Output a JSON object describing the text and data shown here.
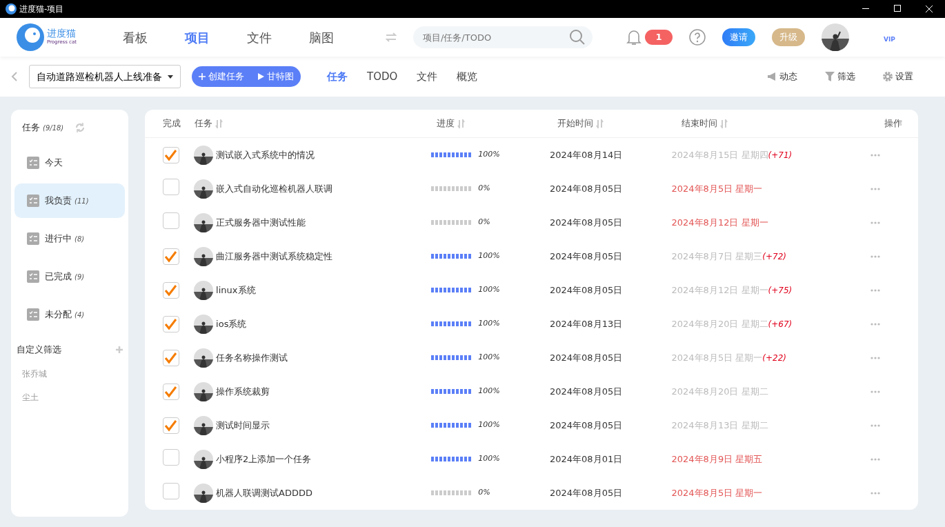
{
  "window": {
    "title": "进度猫-项目"
  },
  "header": {
    "logo_text": "进度猫",
    "logo_sub": "Progress cat",
    "nav": [
      {
        "label": "看板",
        "selected": false
      },
      {
        "label": "项目",
        "selected": true
      },
      {
        "label": "文件",
        "selected": false
      },
      {
        "label": "脑图",
        "selected": false
      }
    ],
    "search": {
      "placeholder": "项目/任务/TODO"
    },
    "notifications": "1",
    "invite": "邀请",
    "upgrade": "升级",
    "vip": "VIP"
  },
  "toolbar": {
    "project": "自动道路巡检机器人上线准备",
    "create": "创建任务",
    "gantt": "甘特图",
    "tabs": [
      {
        "label": "任务",
        "selected": true
      },
      {
        "label": "TODO",
        "selected": false
      },
      {
        "label": "文件",
        "selected": false
      },
      {
        "label": "概览",
        "selected": false
      }
    ],
    "actions": [
      {
        "kind": "activity",
        "label": "动态"
      },
      {
        "kind": "filter",
        "label": "筛选"
      },
      {
        "kind": "settings",
        "label": "设置"
      }
    ]
  },
  "sidebar": {
    "title": "任务",
    "count": "(9/18)",
    "items": [
      {
        "label": "今天",
        "selected": false
      },
      {
        "label": "我负责",
        "count": "(11)",
        "selected": true
      },
      {
        "label": "进行中",
        "count": "(8)",
        "selected": false
      },
      {
        "label": "已完成",
        "count": "(9)",
        "selected": false
      },
      {
        "label": "未分配",
        "count": "(4)",
        "selected": false
      }
    ],
    "custom_title": "自定义筛选",
    "people": [
      "张乔城",
      "尘土"
    ]
  },
  "table": {
    "columns": [
      "完成",
      "任务",
      "进度",
      "开始时间",
      "结束时间",
      "操作"
    ],
    "rows": [
      {
        "checked": true,
        "task": "测试嵌入式系统中的情况",
        "level": 1,
        "progress": "100%",
        "start": "2024年08月14日",
        "end": "2024年8月15日 星期四",
        "overdue": false,
        "delay": "(+71)"
      },
      {
        "checked": false,
        "task": "嵌入式自动化巡检机器人联调",
        "level": 0,
        "progress": "0%",
        "start": "2024年08月05日",
        "end": "2024年8月5日 星期一",
        "overdue": true
      },
      {
        "checked": false,
        "task": "正式服务器中测试性能",
        "level": 0,
        "progress": "0%",
        "start": "2024年08月05日",
        "end": "2024年8月12日 星期一",
        "overdue": true
      },
      {
        "checked": true,
        "task": "曲江服务器中测试系统稳定性",
        "level": 1,
        "progress": "100%",
        "start": "2024年08月05日",
        "end": "2024年8月7日 星期三",
        "overdue": false,
        "delay": "(+72)"
      },
      {
        "checked": true,
        "task": "linux系统",
        "level": 1,
        "progress": "100%",
        "start": "2024年08月05日",
        "end": "2024年8月12日 星期一",
        "overdue": false,
        "delay": "(+75)"
      },
      {
        "checked": true,
        "task": "ios系统",
        "level": 1,
        "progress": "100%",
        "start": "2024年08月13日",
        "end": "2024年8月20日 星期二",
        "overdue": false,
        "delay": "(+67)"
      },
      {
        "checked": true,
        "task": "任务名称操作测试",
        "level": 1,
        "progress": "100%",
        "start": "2024年08月05日",
        "end": "2024年8月5日 星期一",
        "overdue": false,
        "delay": "(+22)"
      },
      {
        "checked": true,
        "task": "操作系统裁剪",
        "level": 1,
        "progress": "100%",
        "start": "2024年08月05日",
        "end": "2024年8月20日 星期二",
        "overdue": false
      },
      {
        "checked": true,
        "task": "测试时间显示",
        "level": 1,
        "progress": "100%",
        "start": "2024年08月05日",
        "end": "2024年8月13日 星期二",
        "overdue": false
      },
      {
        "checked": false,
        "task": "小程序2上添加一个任务",
        "level": 1,
        "progress": "100%",
        "start": "2024年08月01日",
        "end": "2024年8月9日 星期五",
        "overdue": true
      },
      {
        "checked": false,
        "task": "机器人联调测试ADDDD",
        "level": 0,
        "progress": "0%",
        "start": "2024年08月05日",
        "end": "2024年8月5日 星期一",
        "overdue": true
      }
    ]
  }
}
